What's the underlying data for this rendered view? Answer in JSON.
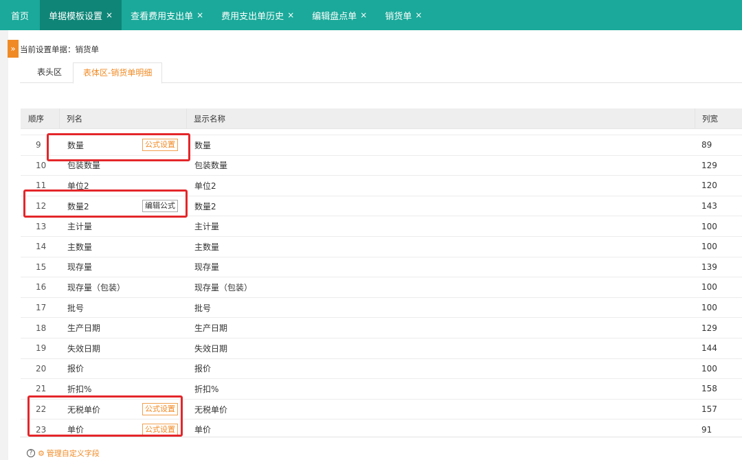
{
  "tabs": [
    {
      "label": "首页",
      "closable": false,
      "active": false
    },
    {
      "label": "单据模板设置",
      "closable": true,
      "active": true
    },
    {
      "label": "查看费用支出单",
      "closable": true,
      "active": false
    },
    {
      "label": "费用支出单历史",
      "closable": true,
      "active": false
    },
    {
      "label": "编辑盘点单",
      "closable": true,
      "active": false
    },
    {
      "label": "销货单",
      "closable": true,
      "active": false
    }
  ],
  "close_glyph": "×",
  "current_doc": "当前设置单据：销货单",
  "subtabs": [
    {
      "label": "表头区",
      "active": false
    },
    {
      "label": "表体区-销货单明细",
      "active": true
    }
  ],
  "table": {
    "headers": {
      "seq": "顺序",
      "name": "列名",
      "display": "显示名称",
      "width": "列宽"
    },
    "rows": [
      {
        "seq": "9",
        "name": "数量",
        "display": "数量",
        "width": "89",
        "action": "公式设置"
      },
      {
        "seq": "10",
        "name": "包装数量",
        "display": "包装数量",
        "width": "129",
        "action": ""
      },
      {
        "seq": "11",
        "name": "单位2",
        "display": "单位2",
        "width": "120",
        "action": ""
      },
      {
        "seq": "12",
        "name": "数量2",
        "display": "数量2",
        "width": "143",
        "action": "编辑公式"
      },
      {
        "seq": "13",
        "name": "主计量",
        "display": "主计量",
        "width": "100",
        "action": ""
      },
      {
        "seq": "14",
        "name": "主数量",
        "display": "主数量",
        "width": "100",
        "action": ""
      },
      {
        "seq": "15",
        "name": "现存量",
        "display": "现存量",
        "width": "139",
        "action": ""
      },
      {
        "seq": "16",
        "name": "现存量（包装）",
        "display": "现存量（包装）",
        "width": "100",
        "action": ""
      },
      {
        "seq": "17",
        "name": "批号",
        "display": "批号",
        "width": "100",
        "action": ""
      },
      {
        "seq": "18",
        "name": "生产日期",
        "display": "生产日期",
        "width": "129",
        "action": ""
      },
      {
        "seq": "19",
        "name": "失效日期",
        "display": "失效日期",
        "width": "144",
        "action": ""
      },
      {
        "seq": "20",
        "name": "报价",
        "display": "报价",
        "width": "100",
        "action": ""
      },
      {
        "seq": "21",
        "name": "折扣%",
        "display": "折扣%",
        "width": "158",
        "action": ""
      },
      {
        "seq": "22",
        "name": "无税单价",
        "display": "无税单价",
        "width": "157",
        "action": "公式设置"
      },
      {
        "seq": "23",
        "name": "单价",
        "display": "单价",
        "width": "91",
        "action": "公式设置"
      }
    ]
  },
  "footer_link": "管理自定义字段",
  "colors": {
    "topbar": "#1aa99a",
    "active_tab": "#0e8577",
    "accent": "#f08a24",
    "highlight": "#e4262a"
  }
}
